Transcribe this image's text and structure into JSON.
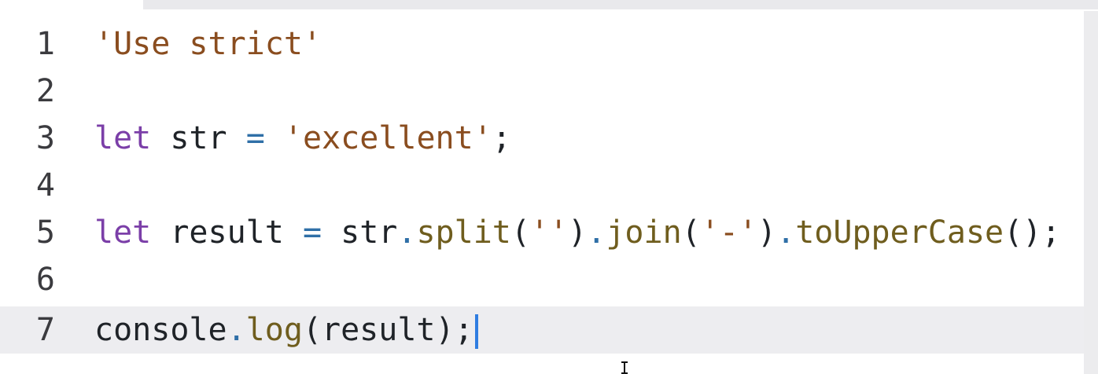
{
  "editor": {
    "lines": [
      {
        "number": "1",
        "tokens": [
          {
            "t": "'Use strict'",
            "c": "str"
          }
        ]
      },
      {
        "number": "2",
        "tokens": []
      },
      {
        "number": "3",
        "tokens": [
          {
            "t": "let",
            "c": "kw"
          },
          {
            "t": " ",
            "c": "id"
          },
          {
            "t": "str",
            "c": "id"
          },
          {
            "t": " ",
            "c": "id"
          },
          {
            "t": "=",
            "c": "op"
          },
          {
            "t": " ",
            "c": "id"
          },
          {
            "t": "'excellent'",
            "c": "str"
          },
          {
            "t": ";",
            "c": "id"
          }
        ]
      },
      {
        "number": "4",
        "tokens": []
      },
      {
        "number": "5",
        "tokens": [
          {
            "t": "let",
            "c": "kw"
          },
          {
            "t": " ",
            "c": "id"
          },
          {
            "t": "result",
            "c": "id"
          },
          {
            "t": " ",
            "c": "id"
          },
          {
            "t": "=",
            "c": "op"
          },
          {
            "t": " ",
            "c": "id"
          },
          {
            "t": "str",
            "c": "id"
          },
          {
            "t": ".",
            "c": "op"
          },
          {
            "t": "split",
            "c": "fn"
          },
          {
            "t": "(",
            "c": "id"
          },
          {
            "t": "''",
            "c": "str"
          },
          {
            "t": ")",
            "c": "id"
          },
          {
            "t": ".",
            "c": "op"
          },
          {
            "t": "join",
            "c": "fn"
          },
          {
            "t": "(",
            "c": "id"
          },
          {
            "t": "'-'",
            "c": "str"
          },
          {
            "t": ")",
            "c": "id"
          },
          {
            "t": ".",
            "c": "op"
          },
          {
            "t": "toUpperCase",
            "c": "fn"
          },
          {
            "t": "();",
            "c": "id"
          }
        ]
      },
      {
        "number": "6",
        "tokens": []
      },
      {
        "number": "7",
        "tokens": [
          {
            "t": "console",
            "c": "id"
          },
          {
            "t": ".",
            "c": "op"
          },
          {
            "t": "log",
            "c": "fn"
          },
          {
            "t": "(result);",
            "c": "id"
          }
        ]
      }
    ],
    "active_line": 7
  },
  "colors": {
    "string": "#8a4d1f",
    "keyword": "#7b3fa8",
    "function": "#6f5d1e",
    "operator": "#2f6fa7",
    "caret": "#2f7de1",
    "active_line_bg": "#ededf0"
  }
}
